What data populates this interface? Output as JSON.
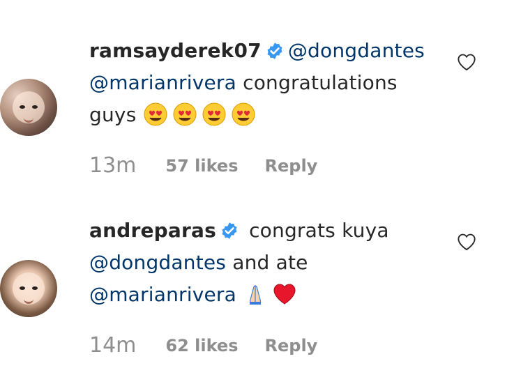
{
  "comments": [
    {
      "username": "ramsayderek07",
      "verified": true,
      "parts": [
        {
          "type": "mention",
          "text": "@dongdantes"
        },
        {
          "type": "text",
          "text": " "
        },
        {
          "type": "mention",
          "text": "@marianrivera"
        },
        {
          "type": "text",
          "text": " congratulations guys "
        }
      ],
      "emojis": [
        "heart-eyes",
        "heart-eyes",
        "heart-eyes",
        "heart-eyes"
      ],
      "time": "13m",
      "likes": "57 likes",
      "reply": "Reply"
    },
    {
      "username": "andreparas",
      "verified": true,
      "parts": [
        {
          "type": "text",
          "text": " congrats kuya "
        },
        {
          "type": "mention",
          "text": "@dongdantes"
        },
        {
          "type": "text",
          "text": " and ate "
        },
        {
          "type": "mention",
          "text": "@marianrivera"
        },
        {
          "type": "text",
          "text": " "
        }
      ],
      "emojis": [
        "folded-hands",
        "red-heart"
      ],
      "time": "14m",
      "likes": "62 likes",
      "reply": "Reply"
    }
  ],
  "colors": {
    "mention": "#003569",
    "meta": "#8e8e8e",
    "verified": "#3897f0"
  }
}
